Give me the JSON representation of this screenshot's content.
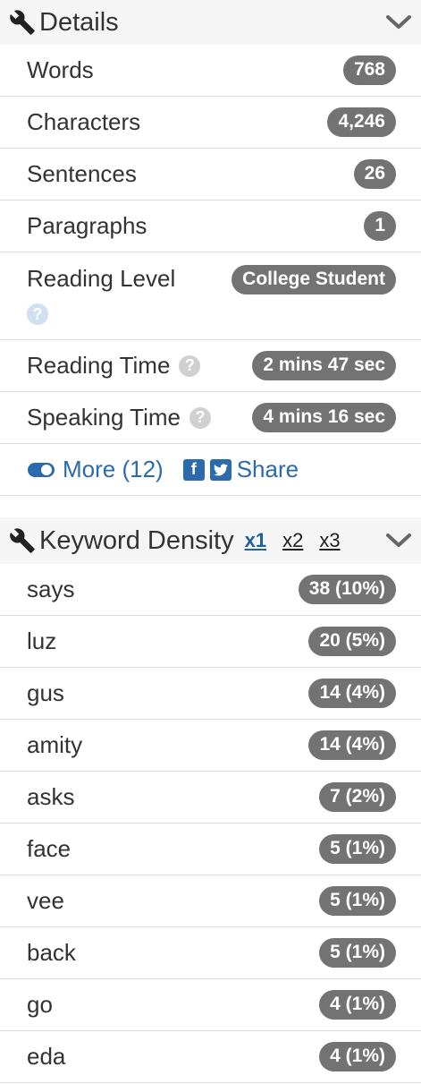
{
  "details": {
    "title": "Details",
    "rows": [
      {
        "label": "Words",
        "value": "768"
      },
      {
        "label": "Characters",
        "value": "4,246"
      },
      {
        "label": "Sentences",
        "value": "26"
      },
      {
        "label": "Paragraphs",
        "value": "1"
      }
    ],
    "reading_level": {
      "label": "Reading Level",
      "value": "College Student"
    },
    "reading_time": {
      "label": "Reading Time",
      "value": "2 mins 47 sec"
    },
    "speaking_time": {
      "label": "Speaking Time",
      "value": "4 mins 16 sec"
    },
    "more_label": "More (12)",
    "share_label": "Share"
  },
  "keyword_density": {
    "title": "Keyword Density",
    "tabs": [
      "x1",
      "x2",
      "x3"
    ],
    "active_tab": "x1",
    "rows": [
      {
        "word": "says",
        "value": "38 (10%)"
      },
      {
        "word": "luz",
        "value": "20 (5%)"
      },
      {
        "word": "gus",
        "value": "14 (4%)"
      },
      {
        "word": "amity",
        "value": "14 (4%)"
      },
      {
        "word": "asks",
        "value": "7 (2%)"
      },
      {
        "word": "face",
        "value": "5 (1%)"
      },
      {
        "word": "vee",
        "value": "5 (1%)"
      },
      {
        "word": "back",
        "value": "5 (1%)"
      },
      {
        "word": "go",
        "value": "4 (1%)"
      },
      {
        "word": "eda",
        "value": "4 (1%)"
      }
    ]
  },
  "icons": {
    "wrench": "wrench-icon",
    "chevron": "chevron-down-icon",
    "help": "question-circle-icon",
    "toggle": "toggle-icon",
    "facebook": "facebook-icon",
    "twitter": "twitter-icon"
  },
  "colors": {
    "badge": "#737373",
    "link": "#2a6aad",
    "header_bg": "#f5f5f5"
  }
}
